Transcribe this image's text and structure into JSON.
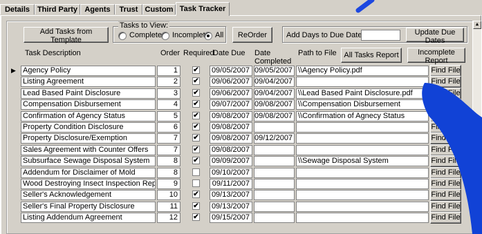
{
  "tabs": [
    {
      "label": "Details",
      "accel": "D"
    },
    {
      "label": "Third Party"
    },
    {
      "label": "Agents",
      "accel": "A"
    },
    {
      "label": "Trust",
      "accel": "u"
    },
    {
      "label": "Custom",
      "accel": "C"
    },
    {
      "label": "Task Tracker"
    }
  ],
  "toolbar": {
    "add_template_label": "Add Tasks from Template",
    "tasks_to_view_legend": "Tasks to View:",
    "radio_complete": "Complete",
    "radio_incomplete": "Incomplete",
    "radio_all": "All",
    "selected_view": "All",
    "reorder_label": "ReOrder",
    "add_days_label": "Add Days to Due Dates:",
    "add_days_value": "",
    "update_due_dates_label": "Update Due Dates",
    "all_tasks_report_label": "All Tasks Report",
    "incomplete_report_label": "Incomplete Report"
  },
  "columns": {
    "task_description": "Task Description",
    "order": "Order",
    "required": "Required",
    "date_due": "Date Due",
    "date_completed_1": "Date",
    "date_completed_2": "Completed",
    "path_to_file": "Path to File"
  },
  "find_file_label": "Find File",
  "record_selector_icon": "right-triangle-icon",
  "rows": [
    {
      "task": "Agency Policy",
      "order": "1",
      "required": true,
      "due": "09/05/2007",
      "completed": "09/05/2007",
      "path": "\\\\Agency Policy.pdf"
    },
    {
      "task": "Listing Agreement",
      "order": "2",
      "required": true,
      "due": "09/06/2007",
      "completed": "09/04/2007",
      "path": ""
    },
    {
      "task": "Lead Based Paint Disclosure",
      "order": "3",
      "required": true,
      "due": "09/06/2007",
      "completed": "09/04/2007",
      "path": "\\\\Lead Based Paint Disclosure.pdf"
    },
    {
      "task": "Compensation Disbursement",
      "order": "4",
      "required": true,
      "due": "09/07/2007",
      "completed": "09/08/2007",
      "path": "\\\\Compensation Disbursement"
    },
    {
      "task": "Confirmation of Agency Status",
      "order": "5",
      "required": true,
      "due": "09/08/2007",
      "completed": "09/08/2007",
      "path": "\\\\Confirmation of Agnecy Status"
    },
    {
      "task": "Property Condition Disclosure",
      "order": "6",
      "required": true,
      "due": "09/08/2007",
      "completed": "",
      "path": ""
    },
    {
      "task": "Property Disclosure/Exemption",
      "order": "7",
      "required": true,
      "due": "09/08/2007",
      "completed": "09/12/2007",
      "path": ""
    },
    {
      "task": "Sales Agreement with Counter Offers",
      "order": "7",
      "required": true,
      "due": "09/08/2007",
      "completed": "",
      "path": ""
    },
    {
      "task": "Subsurface Sewage Disposal System",
      "order": "8",
      "required": true,
      "due": "09/09/2007",
      "completed": "",
      "path": "\\\\Sewage Disposal System"
    },
    {
      "task": "Addendum for Disclaimer of Mold",
      "order": "8",
      "required": false,
      "due": "09/10/2007",
      "completed": "",
      "path": ""
    },
    {
      "task": "Wood Destroying Insect Inspection Report",
      "order": "9",
      "required": false,
      "due": "09/11/2007",
      "completed": "",
      "path": ""
    },
    {
      "task": "Seller's Acknowledgement",
      "order": "10",
      "required": true,
      "due": "09/13/2007",
      "completed": "",
      "path": ""
    },
    {
      "task": "Seller's Final Property Disclosure",
      "order": "11",
      "required": true,
      "due": "09/13/2007",
      "completed": "",
      "path": ""
    },
    {
      "task": "Listing Addendum Agreement",
      "order": "12",
      "required": true,
      "due": "09/15/2007",
      "completed": "",
      "path": ""
    }
  ],
  "overlay_colors": {
    "blue": "#0b3fd4"
  }
}
